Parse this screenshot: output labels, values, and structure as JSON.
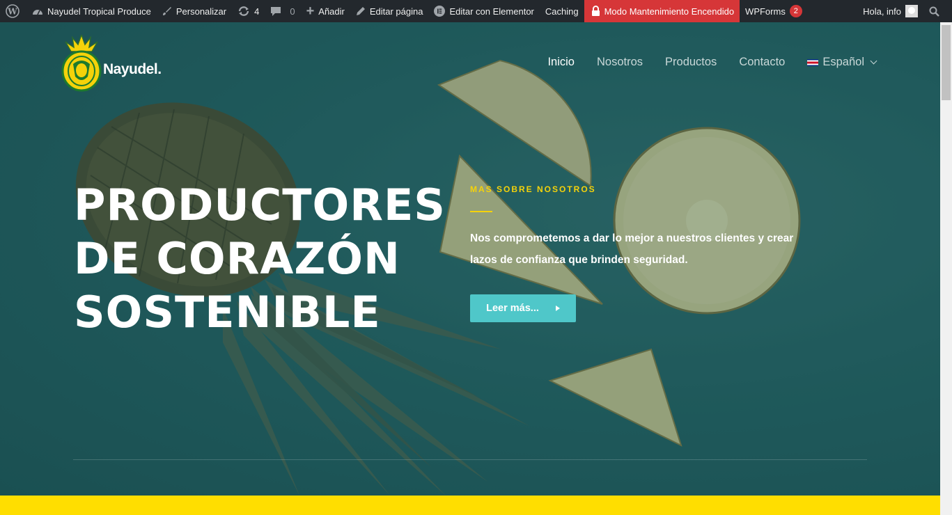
{
  "admin_bar": {
    "site_name": "Nayudel Tropical Produce",
    "customize": "Personalizar",
    "updates_count": "4",
    "comments_count": "0",
    "add_new": "Añadir",
    "edit_page": "Editar página",
    "edit_elementor": "Editar con Elementor",
    "caching": "Caching",
    "maintenance": "Modo Mantenimiento Encendido",
    "wpforms": "WPForms",
    "wpforms_badge": "2",
    "greeting": "Hola, info"
  },
  "logo": {
    "text": "Nayudel."
  },
  "nav": {
    "items": [
      "Inicio",
      "Nosotros",
      "Productos",
      "Contacto"
    ],
    "language": "Español"
  },
  "hero": {
    "headline": [
      "PRODUCTORES",
      "DE CORAZÓN",
      "SOSTENIBLE"
    ],
    "eyebrow": "MAS SOBRE NOSOTROS",
    "description": "Nos comprometemos a dar lo mejor a nuestros clientes y crear lazos de confianza que brinden seguridad.",
    "button": "Leer más..."
  },
  "colors": {
    "admin_bar": "#23282d",
    "maintenance": "#d63638",
    "accent_yellow": "#f5d20a",
    "button": "#4fc7c9",
    "bottom_band": "#ffde00"
  }
}
